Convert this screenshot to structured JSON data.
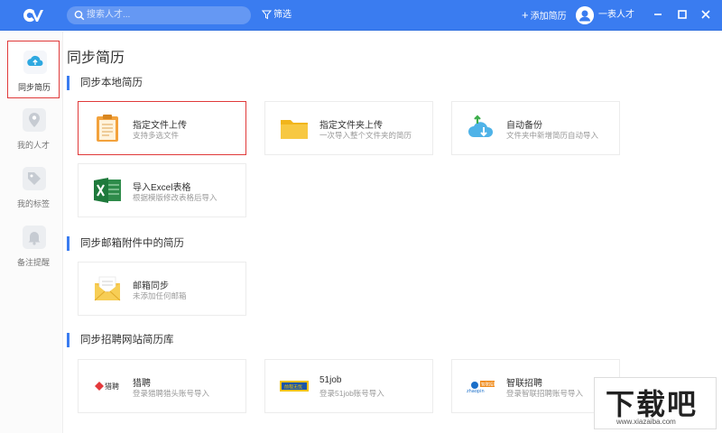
{
  "topbar": {
    "search_placeholder": "搜索人才...",
    "filter_label": "筛选",
    "add_resume_label": "添加简历",
    "user_name": "一表人才",
    "colors": {
      "bar": "#3a7cf0"
    }
  },
  "sidebar": {
    "items": [
      {
        "label": "同步简历",
        "icon": "cloud-upload-icon",
        "active": true
      },
      {
        "label": "我的人才",
        "icon": "person-pin-icon",
        "active": false
      },
      {
        "label": "我的标签",
        "icon": "tag-icon",
        "active": false
      },
      {
        "label": "备注提醒",
        "icon": "bell-icon",
        "active": false
      }
    ]
  },
  "main": {
    "title": "同步简历",
    "sections": [
      {
        "heading": "同步本地简历",
        "cards": [
          {
            "title": "指定文件上传",
            "subtitle": "支持多选文件",
            "icon": "clipboard-file-icon"
          },
          {
            "title": "指定文件夹上传",
            "subtitle": "一次导入整个文件夹的简历",
            "icon": "folder-icon"
          },
          {
            "title": "自动备份",
            "subtitle": "文件夹中新增简历自动导入",
            "icon": "cloud-sync-icon"
          },
          {
            "title": "导入Excel表格",
            "subtitle": "根据模版修改表格后导入",
            "icon": "excel-icon"
          }
        ]
      },
      {
        "heading": "同步邮箱附件中的简历",
        "cards": [
          {
            "title": "邮箱同步",
            "subtitle": "未添加任何邮箱",
            "icon": "mail-envelope-icon"
          }
        ]
      },
      {
        "heading": "同步招聘网站简历库",
        "cards": [
          {
            "title": "猎聘",
            "subtitle": "登录猎聘猎头账号导入",
            "icon": "liepin-logo-icon"
          },
          {
            "title": "51job",
            "subtitle": "登录51job账号导入",
            "icon": "51job-logo-icon"
          },
          {
            "title": "智联招聘",
            "subtitle": "登录智联招聘账号导入",
            "icon": "zhaopin-logo-icon"
          }
        ]
      }
    ]
  },
  "watermark": {
    "big": "下载吧",
    "small": "www.xiazaiba.com"
  }
}
